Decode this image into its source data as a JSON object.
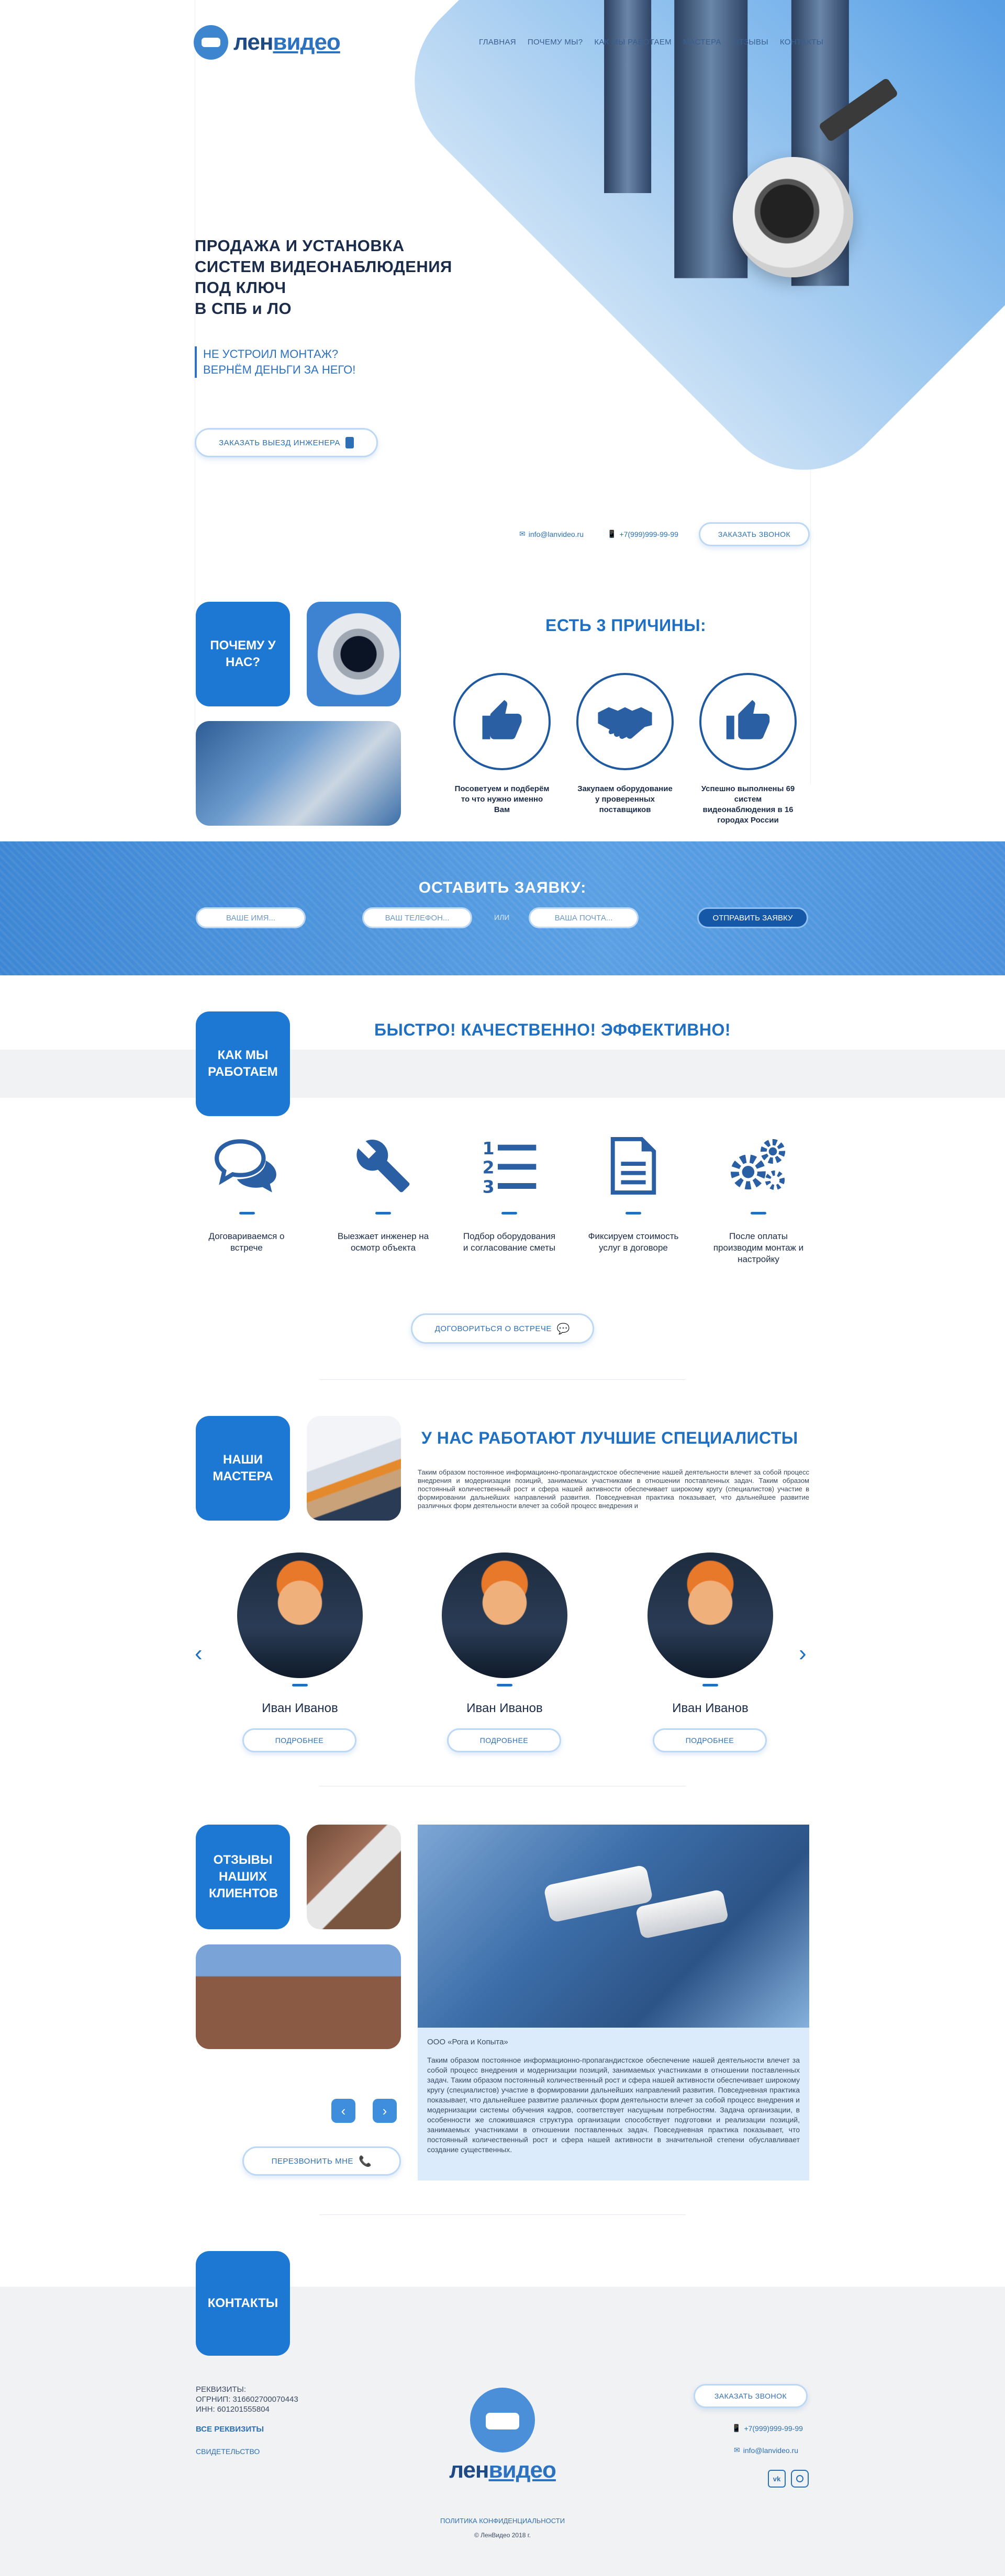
{
  "brand": {
    "prefix": "лен",
    "suffix": "видео"
  },
  "nav": [
    "ГЛАВНАЯ",
    "ПОЧЕМУ МЫ?",
    "КАК МЫ РАБОТАЕМ",
    "МАСТЕРА",
    "ОТЗЫВЫ",
    "КОНТАКТЫ"
  ],
  "hero": {
    "title_lines": [
      "ПРОДАЖА И УСТАНОВКА",
      "СИСТЕМ ВИДЕОНАБЛЮДЕНИЯ",
      "ПОД КЛЮЧ",
      "В СПБ и ЛО"
    ],
    "guarantee_lines": [
      "НЕ УСТРОИЛ МОНТАЖ?",
      "ВЕРНЁМ ДЕНЬГИ ЗА НЕГО!"
    ],
    "cta": "ЗАКАЗАТЬ ВЫЕЗД ИНЖЕНЕРА",
    "email": "info@lanvideo.ru",
    "phone": "+7(999)999-99-99",
    "callback": "ЗАКАЗАТЬ ЗВОНОК"
  },
  "why": {
    "tile": "ПОЧЕМУ У НАС?",
    "title": "ЕСТЬ 3 ПРИЧИНЫ:",
    "reasons": [
      {
        "icon": "thumbs-up-icon",
        "text": "Посоветуем и подберём то что нужно именно Вам"
      },
      {
        "icon": "handshake-icon",
        "text": "Закупаем оборудование у проверенных поставщиков"
      },
      {
        "icon": "like-icon",
        "text": "Успешно выполнены 69 систем видеонаблюдения в 16 городах России"
      }
    ]
  },
  "request": {
    "title": "ОСТАВИТЬ ЗАЯВКУ:",
    "name_placeholder": "ВАШЕ ИМЯ...",
    "phone_placeholder": "ВАШ ТЕЛЕФОН...",
    "or": "ИЛИ",
    "email_placeholder": "ВАША ПОЧТА...",
    "submit": "ОТПРАВИТЬ ЗАЯВКУ"
  },
  "how": {
    "tile": "КАК МЫ РАБОТАЕМ",
    "title": "БЫСТРО! КАЧЕСТВЕННО! ЭФФЕКТИВНО!",
    "steps": [
      {
        "icon": "chat-bubbles-icon",
        "text": "Договариваемся о встрече"
      },
      {
        "icon": "wrench-icon",
        "text": "Выезжает инженер на осмотр объекта"
      },
      {
        "icon": "numbered-list-icon",
        "text": "Подбор оборудования и согласование сметы"
      },
      {
        "icon": "document-icon",
        "text": "Фиксируем стоимость услуг в договоре"
      },
      {
        "icon": "gears-icon",
        "text": "После оплаты производим монтаж и настройку"
      }
    ],
    "cta": "ДОГОВОРИТЬСЯ О ВСТРЕЧЕ"
  },
  "masters": {
    "tile": "НАШИ МАСТЕРА",
    "title": "У НАС РАБОТАЮТ ЛУЧШИЕ СПЕЦИАЛИСТЫ",
    "intro": "Таким образом постоянное информационно-пропагандистское обеспечение нашей деятельности влечет за собой процесс внедрения и модернизации позиций, занимаемых участниками в отношении поставленных задач. Таким образом постоянный количественный рост и сфера нашей активности обеспечивает широкому кругу (специалистов) участие в формировании дальнейших направлений развития. Повседневная практика показывает, что дальнейшее развитие различных форм деятельности влечет за собой процесс внедрения и",
    "people": [
      {
        "name": "Иван Иванов",
        "more": "ПОДРОБНЕЕ"
      },
      {
        "name": "Иван Иванов",
        "more": "ПОДРОБНЕЕ"
      },
      {
        "name": "Иван Иванов",
        "more": "ПОДРОБНЕЕ"
      }
    ]
  },
  "reviews": {
    "tile": "ОТЗЫВЫ НАШИХ КЛИЕНТОВ",
    "company": "ООО «Рога и Копыта»",
    "text": "Таким образом постоянное информационно-пропагандистское обеспечение нашей деятельности влечет за собой процесс внедрения и модернизации позиций, занимаемых участниками в отношении поставленных задач. Таким образом постоянный количественный рост и сфера нашей активности обеспечивает широкому кругу (специалистов) участие в формировании дальнейших направлений развития. Повседневная практика показывает, что дальнейшее развитие различных форм деятельности влечет за собой процесс внедрения и модернизации системы обучения кадров, соответствует насущным потребностям. Задача организации, в особенности же сложившаяся структура организации способствует подготовки и реализации позиций, занимаемых участниками в отношении поставленных задач. Повседневная практика показывает, что постоянный количественный рост и сфера нашей активности в значительной степени обуславливает создание существенных.",
    "callback": "ПЕРЕЗВОНИТЬ МНЕ"
  },
  "footer": {
    "tile": "КОНТАКТЫ",
    "req_title": "РЕКВИЗИТЫ:",
    "ogrnip": "ОГРНИП: 316602700070443",
    "inn": "ИНН: 601201555804",
    "all_req": "ВСЕ РЕКВИЗИТЫ",
    "cert": "СВИДЕТЕЛЬСТВО",
    "callback": "ЗАКАЗАТЬ ЗВОНОК",
    "phone": "+7(999)999-99-99",
    "email": "info@lanvideo.ru",
    "privacy": "ПОЛИТИКА КОНФИДЕНЦИАЛЬНОСТИ",
    "copyright": "© ЛенВидео 2018 г."
  },
  "colors": {
    "accent": "#1d78d4",
    "dark": "#1b2b4a",
    "band": "#4a90db",
    "footer_bg": "#f1f2f4"
  }
}
